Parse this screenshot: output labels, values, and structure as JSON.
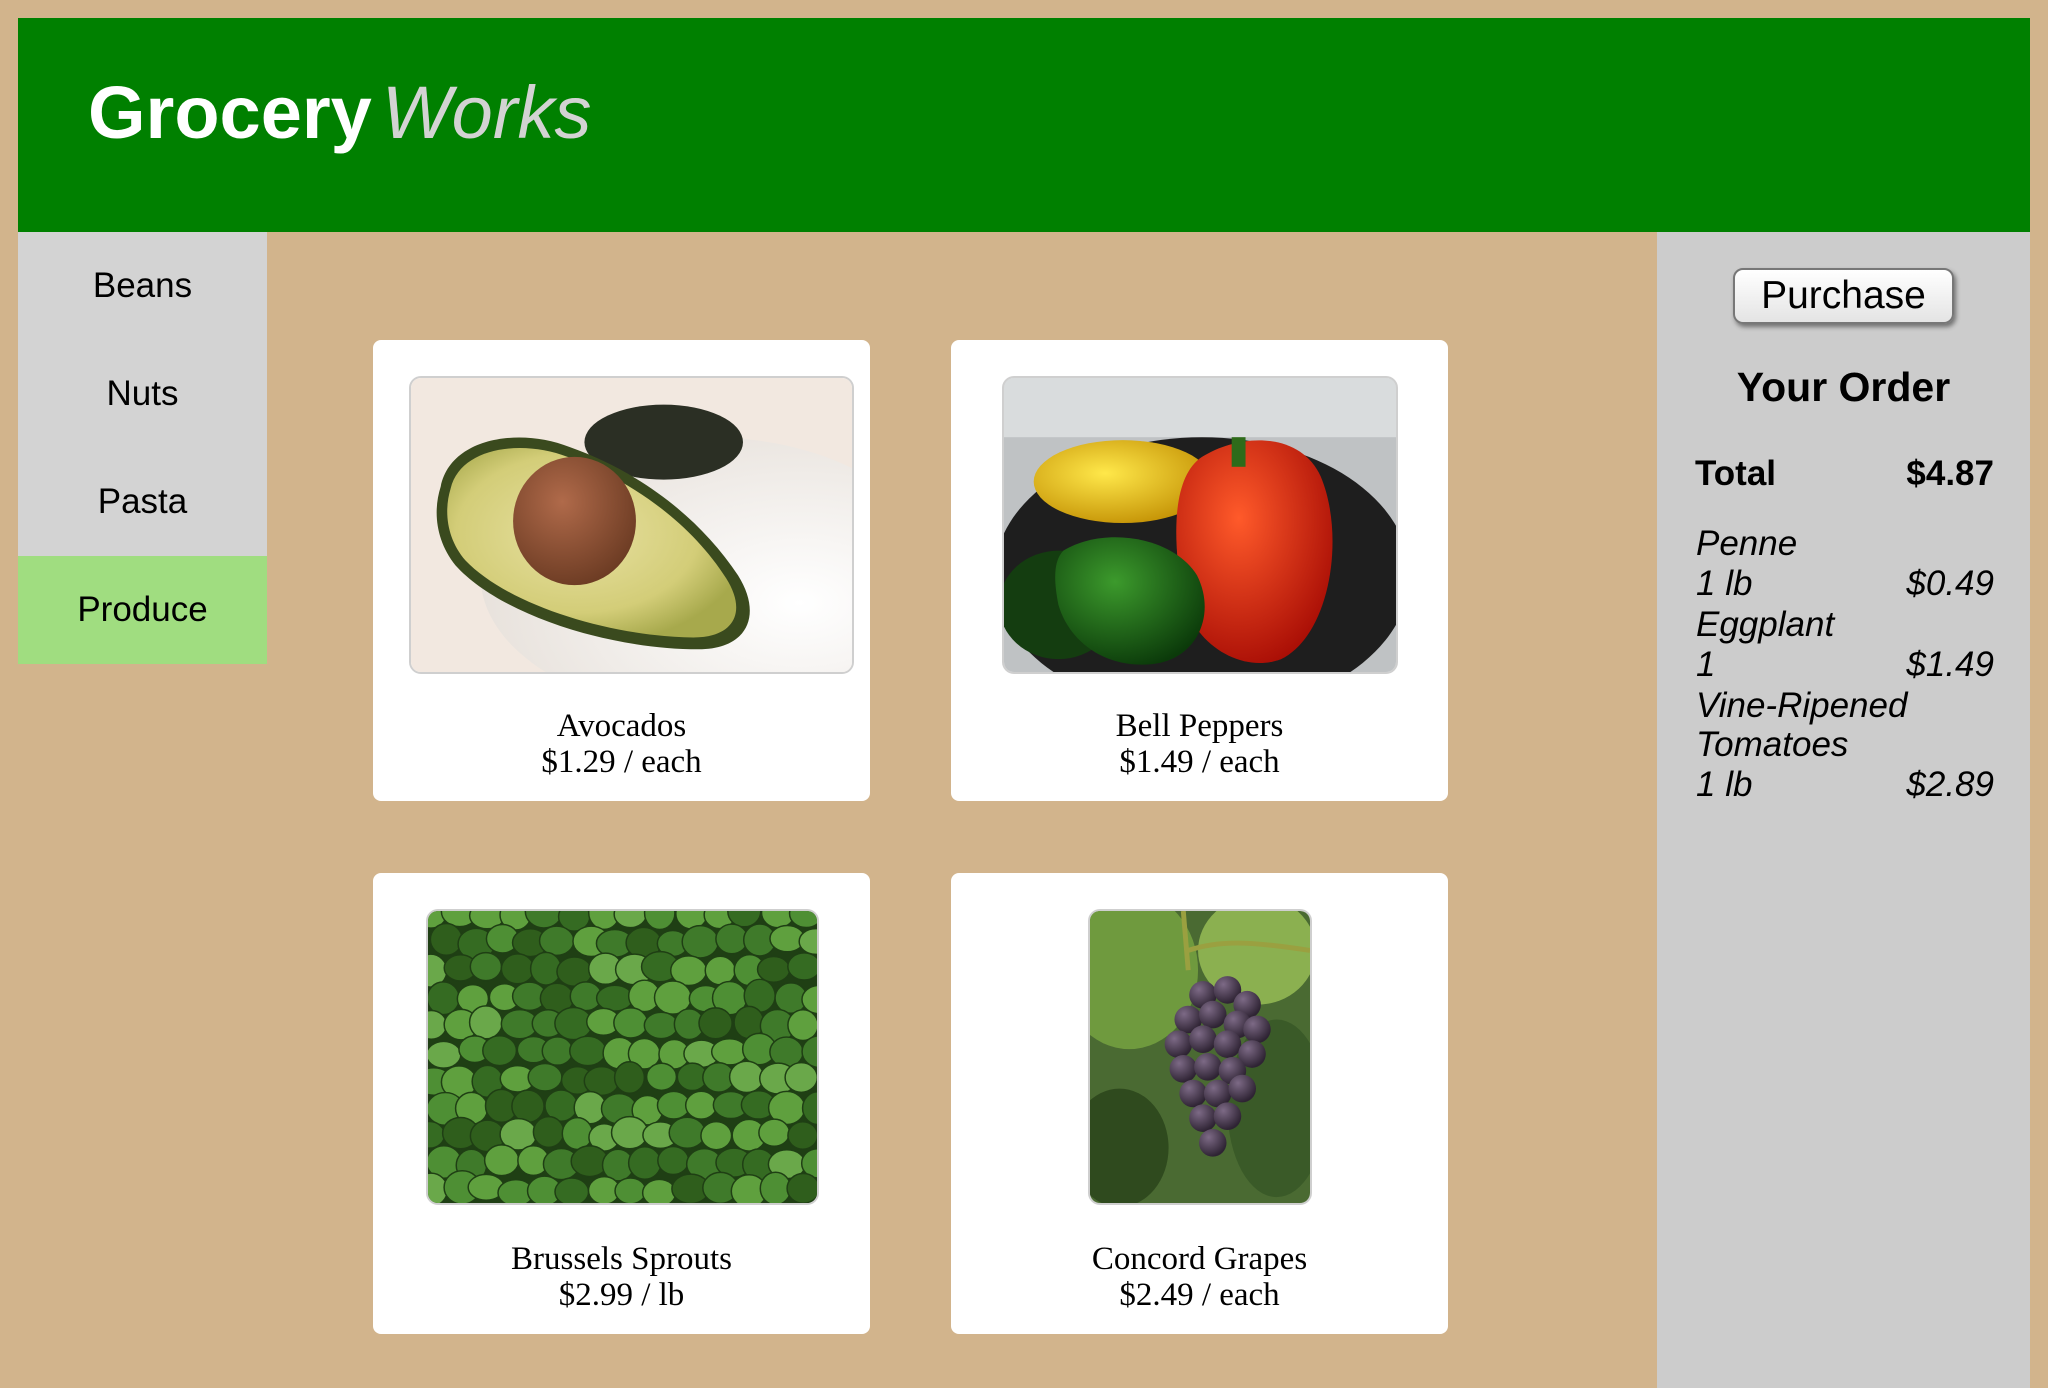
{
  "header": {
    "logo_primary": "Grocery",
    "logo_secondary": "Works"
  },
  "nav": {
    "items": [
      {
        "label": "Beans",
        "active": false
      },
      {
        "label": "Nuts",
        "active": false
      },
      {
        "label": "Pasta",
        "active": false
      },
      {
        "label": "Produce",
        "active": true
      }
    ]
  },
  "products": [
    {
      "name": "Avocados",
      "price": "$1.29 / each",
      "image": "avocado-photo"
    },
    {
      "name": "Bell Peppers",
      "price": "$1.49 / each",
      "image": "bell-peppers-photo"
    },
    {
      "name": "Brussels Sprouts",
      "price": "$2.99 / lb",
      "image": "brussels-sprouts-photo"
    },
    {
      "name": "Concord Grapes",
      "price": "$2.49 / each",
      "image": "concord-grapes-photo"
    }
  ],
  "order": {
    "purchase_label": "Purchase",
    "title": "Your Order",
    "total_label": "Total",
    "total_value": "$4.87",
    "items": [
      {
        "name": "Penne",
        "qty": "1 lb",
        "price": "$0.49"
      },
      {
        "name": "Eggplant",
        "qty": "1",
        "price": "$1.49"
      },
      {
        "name": "Vine-Ripened Tomatoes",
        "qty": "1 lb",
        "price": "$2.89"
      }
    ]
  },
  "colors": {
    "page_background": "#d2b48c",
    "header_background": "#008000",
    "nav_background": "#d3d3d3",
    "nav_active": "#a0dd80",
    "order_background": "#cccccc"
  }
}
